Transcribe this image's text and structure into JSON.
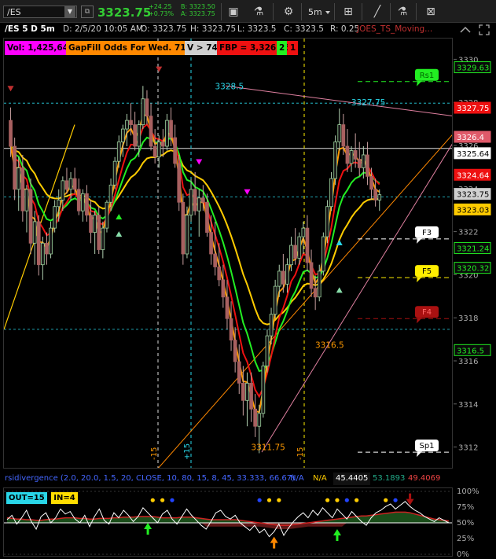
{
  "toolbar": {
    "symbol": "/ES",
    "last_price": "3323.75",
    "change": "+24.25",
    "change_pct": "+0.73%",
    "bid": "B: 3323.50",
    "ask": "A: 3323.75",
    "period": "5m",
    "icons": [
      "gear-icon",
      "beaker-icon",
      "settings-icon",
      "period-dropdown",
      "grid-icon",
      "drawing-icon",
      "magnet-icon",
      "flask-icon",
      "close-grid-icon"
    ]
  },
  "info": {
    "title": "/ES 5 D 5m",
    "datetime": "D: 2/5/20 10:05 AM",
    "open": "O: 3323.75",
    "high": "H: 3323.75",
    "low": "L: 3323.5",
    "close": "C: 3323.5",
    "range": "R: 0.25",
    "study": "JOES_TS_Moving..."
  },
  "labels": {
    "vol": "Vol: 1,425,645",
    "gapfill": "GapFill Odds For Wed. 71%",
    "v74": "V > 74",
    "fbp": "FBP = 3,326.25",
    "n2": "2",
    "n1": "1"
  },
  "colors": {
    "background": "#000000",
    "up": "#22dd22",
    "down": "#c05050",
    "ma_red": "#ee1111",
    "ma_green": "#22ee22",
    "ma_orange": "#ff9900",
    "ma_yellow": "#ffcc00",
    "accent_cyan": "#29d6e8",
    "magenta": "#ff00ff"
  },
  "chart_data": {
    "type": "candlestick",
    "ylim": [
      3311,
      3331
    ],
    "yticks": [
      3330,
      3328,
      3326,
      3324,
      3322,
      3320,
      3318,
      3316,
      3314,
      3312
    ],
    "scale_badges": [
      {
        "value": "3329.63",
        "price": 3329.63,
        "bg": "#0a0a0a",
        "fg": "#22ee22",
        "border": "#22ee22"
      },
      {
        "value": "3327.75",
        "price": 3327.75,
        "bg": "#ee1111",
        "fg": "#ffffff",
        "border": "#ee1111"
      },
      {
        "value": "3326.4",
        "price": 3326.4,
        "bg": "#e05a6a",
        "fg": "#ffffff",
        "border": "#e05a6a"
      },
      {
        "value": "3325.64",
        "price": 3325.64,
        "bg": "#ffffff",
        "fg": "#000000",
        "border": "#ffffff"
      },
      {
        "value": "3324.64",
        "price": 3324.64,
        "bg": "#ee1111",
        "fg": "#ffffff",
        "border": "#ee1111"
      },
      {
        "value": "3323.75",
        "price": 3323.75,
        "bg": "#d0d0d0",
        "fg": "#000000",
        "border": "#d0d0d0"
      },
      {
        "value": "3323.03",
        "price": 3323.03,
        "bg": "#ffcc00",
        "fg": "#000000",
        "border": "#ffcc00"
      },
      {
        "value": "3321.24",
        "price": 3321.24,
        "bg": "#0a0a0a",
        "fg": "#22ee22",
        "border": "#22ee22"
      },
      {
        "value": "3320.32",
        "price": 3320.32,
        "bg": "#0a0a0a",
        "fg": "#22ee22",
        "border": "#22ee22"
      },
      {
        "value": "3316.5",
        "price": 3316.5,
        "bg": "#0a0a0a",
        "fg": "#22ee22",
        "border": "#22ee22"
      }
    ],
    "price_annotations": [
      {
        "text": "3328.5",
        "price": 3328.5,
        "bar": 55,
        "color": "#29d6e8"
      },
      {
        "text": "3327.75",
        "price": 3327.75,
        "bar": 89,
        "color": "#29d6e8"
      },
      {
        "text": "3316.5",
        "price": 3316.5,
        "bar": 80,
        "color": "#ff9900"
      },
      {
        "text": "3311.75",
        "price": 3311.75,
        "bar": 64,
        "color": "#ff9900"
      }
    ],
    "level_tags": [
      {
        "text": "Rs1",
        "price": 3329.0,
        "bg": "#22ee22",
        "fg": "#006600",
        "line": "#22ee22"
      },
      {
        "text": "F3",
        "price": 3321.7,
        "bg": "#ffffff",
        "fg": "#000000",
        "line": "#ffffff"
      },
      {
        "text": "F5",
        "price": 3319.9,
        "bg": "#ffee00",
        "fg": "#000000",
        "line": "#ffee00"
      },
      {
        "text": "F4",
        "price": 3318.0,
        "bg": "#aa1111",
        "fg": "#ff6666",
        "line": "#aa1111"
      },
      {
        "text": "Sp1",
        "price": 3311.8,
        "bg": "#ffffff",
        "fg": "#000000",
        "line": "#ffffff"
      }
    ],
    "vline_labels": [
      "-15",
      "+15",
      "-15"
    ],
    "candles": [
      [
        3327.2,
        3327.8,
        3325.5,
        3326.0
      ],
      [
        3326.0,
        3326.4,
        3323.5,
        3324.0
      ],
      [
        3324.0,
        3325.5,
        3323.0,
        3325.0
      ],
      [
        3325.0,
        3325.6,
        3322.5,
        3323.0
      ],
      [
        3323.0,
        3324.2,
        3322.0,
        3324.0
      ],
      [
        3324.0,
        3324.5,
        3321.0,
        3321.5
      ],
      [
        3321.5,
        3323.0,
        3320.5,
        3322.5
      ],
      [
        3322.5,
        3322.8,
        3320.0,
        3320.5
      ],
      [
        3320.5,
        3321.8,
        3319.8,
        3321.5
      ],
      [
        3321.5,
        3322.0,
        3320.5,
        3321.0
      ],
      [
        3321.0,
        3322.5,
        3320.8,
        3322.2
      ],
      [
        3322.2,
        3323.5,
        3322.0,
        3323.2
      ],
      [
        3323.2,
        3324.0,
        3322.5,
        3323.5
      ],
      [
        3323.5,
        3324.6,
        3323.0,
        3324.4
      ],
      [
        3324.4,
        3325.0,
        3323.8,
        3324.0
      ],
      [
        3324.0,
        3324.8,
        3323.5,
        3324.5
      ],
      [
        3324.5,
        3325.0,
        3323.8,
        3324.0
      ],
      [
        3324.0,
        3324.5,
        3322.8,
        3323.0
      ],
      [
        3323.0,
        3324.0,
        3322.5,
        3323.8
      ],
      [
        3323.8,
        3324.2,
        3322.5,
        3322.8
      ],
      [
        3322.8,
        3323.5,
        3321.5,
        3322.0
      ],
      [
        3322.0,
        3323.0,
        3321.0,
        3322.8
      ],
      [
        3322.8,
        3323.2,
        3321.0,
        3321.2
      ],
      [
        3321.2,
        3322.5,
        3320.8,
        3322.2
      ],
      [
        3322.2,
        3323.5,
        3322.0,
        3323.4
      ],
      [
        3323.4,
        3324.5,
        3323.0,
        3324.2
      ],
      [
        3324.2,
        3325.5,
        3324.0,
        3325.3
      ],
      [
        3325.3,
        3326.5,
        3325.0,
        3326.2
      ],
      [
        3326.2,
        3327.0,
        3325.5,
        3326.8
      ],
      [
        3326.8,
        3327.5,
        3326.0,
        3327.2
      ],
      [
        3327.2,
        3328.0,
        3326.5,
        3327.0
      ],
      [
        3327.0,
        3327.6,
        3325.8,
        3326.0
      ],
      [
        3326.0,
        3327.2,
        3325.5,
        3327.0
      ],
      [
        3327.0,
        3328.8,
        3326.8,
        3328.2
      ],
      [
        3328.2,
        3328.6,
        3327.0,
        3327.4
      ],
      [
        3327.4,
        3328.0,
        3325.8,
        3326.0
      ],
      [
        3326.0,
        3326.8,
        3325.2,
        3325.5
      ],
      [
        3325.5,
        3326.5,
        3325.0,
        3326.2
      ],
      [
        3326.2,
        3326.8,
        3325.5,
        3326.0
      ],
      [
        3326.0,
        3327.5,
        3325.8,
        3327.2
      ],
      [
        3327.2,
        3327.8,
        3326.0,
        3326.4
      ],
      [
        3326.4,
        3327.0,
        3325.0,
        3325.2
      ],
      [
        3325.2,
        3325.6,
        3323.0,
        3323.4
      ],
      [
        3323.4,
        3323.8,
        3320.5,
        3321.0
      ],
      [
        3321.0,
        3323.2,
        3320.8,
        3322.8
      ],
      [
        3322.8,
        3324.5,
        3322.5,
        3324.0
      ],
      [
        3324.0,
        3324.8,
        3322.8,
        3323.0
      ],
      [
        3323.0,
        3324.0,
        3321.8,
        3323.6
      ],
      [
        3323.6,
        3324.2,
        3323.0,
        3323.4
      ],
      [
        3323.4,
        3323.8,
        3321.8,
        3322.0
      ],
      [
        3322.0,
        3322.8,
        3320.5,
        3321.0
      ],
      [
        3321.0,
        3322.5,
        3320.0,
        3320.4
      ],
      [
        3320.4,
        3321.5,
        3319.5,
        3319.8
      ],
      [
        3319.8,
        3320.5,
        3318.5,
        3319.0
      ],
      [
        3319.0,
        3319.8,
        3317.5,
        3318.0
      ],
      [
        3318.0,
        3318.8,
        3316.5,
        3317.0
      ],
      [
        3317.0,
        3317.6,
        3315.5,
        3316.0
      ],
      [
        3316.0,
        3316.8,
        3314.5,
        3315.0
      ],
      [
        3315.0,
        3315.8,
        3313.5,
        3314.2
      ],
      [
        3314.2,
        3315.5,
        3313.0,
        3315.0
      ],
      [
        3315.0,
        3315.5,
        3313.2,
        3313.8
      ],
      [
        3313.8,
        3314.5,
        3312.5,
        3313.0
      ],
      [
        3313.0,
        3314.0,
        3311.75,
        3313.6
      ],
      [
        3313.6,
        3316.0,
        3313.4,
        3315.8
      ],
      [
        3315.8,
        3317.5,
        3315.5,
        3317.2
      ],
      [
        3317.2,
        3318.5,
        3316.8,
        3318.2
      ],
      [
        3318.2,
        3319.8,
        3318.0,
        3319.5
      ],
      [
        3319.5,
        3320.5,
        3319.0,
        3320.2
      ],
      [
        3320.2,
        3321.0,
        3319.2,
        3319.6
      ],
      [
        3319.6,
        3320.8,
        3319.2,
        3320.5
      ],
      [
        3320.5,
        3321.8,
        3320.2,
        3321.4
      ],
      [
        3321.4,
        3322.2,
        3320.5,
        3320.8
      ],
      [
        3320.8,
        3322.0,
        3320.5,
        3321.8
      ],
      [
        3321.8,
        3322.5,
        3321.0,
        3322.2
      ],
      [
        3322.2,
        3322.8,
        3320.2,
        3320.6
      ],
      [
        3320.6,
        3321.2,
        3319.0,
        3319.4
      ],
      [
        3319.4,
        3320.0,
        3318.4,
        3319.0
      ],
      [
        3319.0,
        3320.5,
        3318.8,
        3320.2
      ],
      [
        3320.2,
        3322.0,
        3320.0,
        3321.8
      ],
      [
        3321.8,
        3323.5,
        3321.5,
        3323.2
      ],
      [
        3323.2,
        3324.8,
        3323.0,
        3324.5
      ],
      [
        3324.5,
        3326.5,
        3324.2,
        3326.2
      ],
      [
        3326.2,
        3327.75,
        3325.8,
        3327.0
      ],
      [
        3327.0,
        3327.5,
        3325.6,
        3326.0
      ],
      [
        3326.0,
        3326.8,
        3324.8,
        3325.2
      ],
      [
        3325.2,
        3326.0,
        3324.8,
        3325.8
      ],
      [
        3325.8,
        3326.6,
        3325.0,
        3325.4
      ],
      [
        3325.4,
        3326.2,
        3324.6,
        3325.0
      ],
      [
        3325.0,
        3326.0,
        3324.5,
        3325.6
      ],
      [
        3325.6,
        3326.2,
        3324.2,
        3324.6
      ],
      [
        3324.6,
        3325.0,
        3323.5,
        3324.0
      ],
      [
        3324.0,
        3324.5,
        3323.2,
        3323.5
      ],
      [
        3323.5,
        3324.0,
        3323.0,
        3323.75
      ]
    ]
  },
  "subchart": {
    "title": "rsidivergence (2.0, 20.0, 1.5, 20, CLOSE, 10, 80, 15, 8, 45, 33.333, 66.67)",
    "na1": "N/A",
    "na2": "N/A",
    "v1": "45.4405",
    "v2": "53.1893",
    "v3": "49.4069",
    "out_label": "OUT=15",
    "in_label": "IN=4",
    "yticks": [
      "100%",
      "75%",
      "50%",
      "25%",
      "0%"
    ],
    "ylim": [
      0,
      100
    ],
    "rsi": [
      55,
      62,
      48,
      58,
      70,
      52,
      40,
      60,
      66,
      50,
      58,
      72,
      64,
      68,
      56,
      50,
      62,
      44,
      60,
      72,
      54,
      48,
      66,
      58,
      70,
      62,
      52,
      60,
      74,
      66,
      58,
      50,
      64,
      70,
      56,
      48,
      60,
      72,
      62,
      54,
      46,
      40,
      52,
      66,
      70,
      60,
      56,
      62,
      50,
      44,
      38,
      46,
      34,
      40,
      28,
      36,
      48,
      30,
      42,
      52,
      60,
      66,
      58,
      70,
      62,
      74,
      66,
      58,
      72,
      64,
      56,
      68,
      60,
      52,
      46,
      58,
      66,
      70,
      76,
      80,
      72,
      78,
      84,
      76,
      70,
      66,
      60,
      56,
      52,
      58,
      54,
      50
    ],
    "band": [
      58,
      57,
      56,
      56,
      55,
      55,
      54,
      54,
      55,
      56,
      56,
      57,
      58,
      58,
      58,
      57,
      57,
      56,
      56,
      57,
      57,
      57,
      58,
      58,
      59,
      59,
      59,
      60,
      60,
      60,
      60,
      59,
      58,
      58,
      58,
      58,
      59,
      59,
      59,
      58,
      57,
      56,
      55,
      55,
      55,
      55,
      55,
      55,
      54,
      53,
      52,
      51,
      50,
      49,
      48,
      47,
      46,
      46,
      46,
      47,
      48,
      49,
      50,
      51,
      52,
      53,
      54,
      55,
      56,
      57,
      58,
      59,
      60,
      61,
      61,
      62,
      63,
      64,
      65,
      66,
      67,
      67,
      67,
      66,
      64,
      62,
      60,
      58,
      56,
      55,
      54,
      53
    ]
  }
}
